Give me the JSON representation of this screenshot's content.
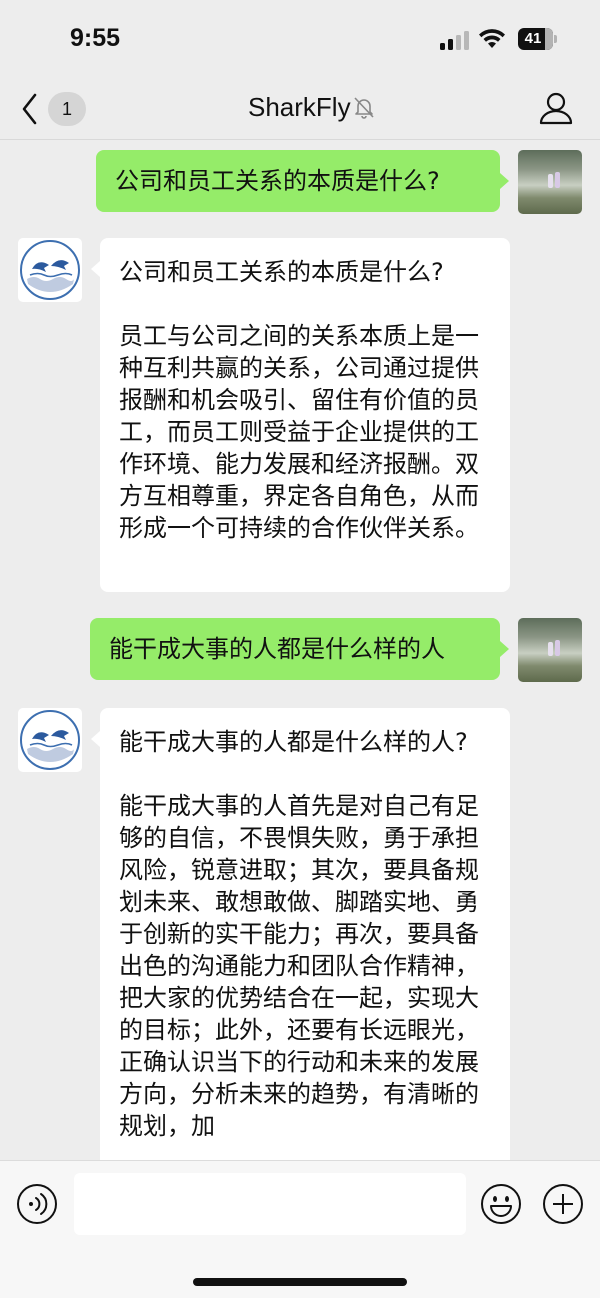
{
  "status_bar": {
    "time": "9:55",
    "battery": "41"
  },
  "nav": {
    "back_count": "1",
    "title": "SharkFly"
  },
  "messages": [
    {
      "from": "me",
      "text": "公司和员工关系的本质是什么?"
    },
    {
      "from": "bot",
      "question": "公司和员工关系的本质是什么?",
      "answer": "员工与公司之间的关系本质上是一种互利共赢的关系，公司通过提供报酬和机会吸引、留住有价值的员工，而员工则受益于企业提供的工作环境、能力发展和经济报酬。双方互相尊重，界定各自角色，从而形成一个可持续的合作伙伴关系。"
    },
    {
      "from": "me",
      "text": "能干成大事的人都是什么样的人"
    },
    {
      "from": "bot",
      "question": "能干成大事的人都是什么样的人?",
      "answer": "能干成大事的人首先是对自己有足够的自信，不畏惧失败，勇于承担风险，锐意进取；其次，要具备规划未来、敢想敢做、脚踏实地、勇于创新的实干能力；再次，要具备出色的沟通能力和团队合作精神，把大家的优势结合在一起，实现大的目标；此外，还要有长远眼光，正确认识当下的行动和未来的发展方向，分析未来的趋势，有清晰的规划，加"
    }
  ],
  "colors": {
    "outgoing_bubble": "#95ec69",
    "incoming_bubble": "#ffffff",
    "background": "#ededed"
  },
  "icons": [
    "chevron-left-icon",
    "mute-bell-icon",
    "profile-icon",
    "voice-icon",
    "emoji-icon",
    "plus-icon",
    "dolphin-logo-icon"
  ]
}
